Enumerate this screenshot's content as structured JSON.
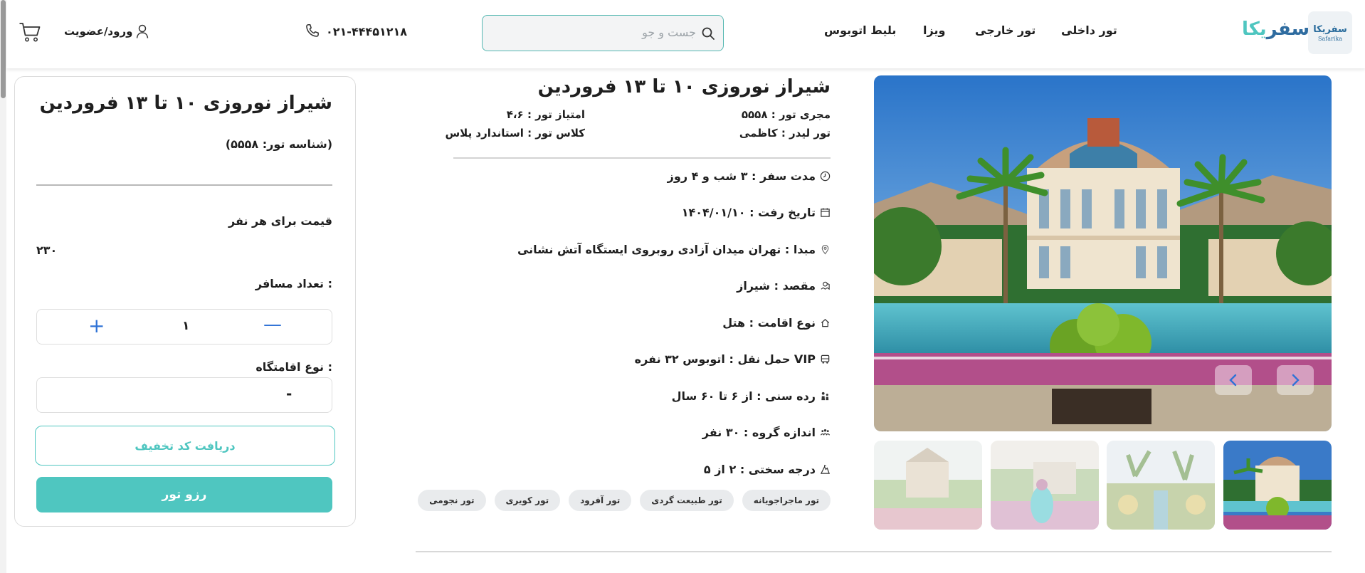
{
  "header": {
    "logo_text_part1": "سفر",
    "logo_text_part2": "یکا",
    "logo_mark": "سفریکا",
    "logo_sub": "Safarika",
    "nav": [
      "تور داخلی",
      "تور خارجی",
      "ویزا",
      "بلیط اتوبوس"
    ],
    "search_placeholder": "جست و جو",
    "phone": "۰۲۱-۴۴۴۵۱۲۱۸",
    "login_label": "ورود/عضویت"
  },
  "gallery": {
    "thumbnail_count": 4,
    "selected_thumbnail": 1
  },
  "tour": {
    "title": "شیراز نوروزی ۱۰ تا ۱۳ فروردین",
    "operator": "مجری تور : ۵۵۵۸",
    "rating": "امتیاز تور : ۴،۶",
    "leader": "تور لیدر : کاظمی",
    "class": "کلاس تور : استاندارد پلاس",
    "details": [
      {
        "icon": "clock-icon",
        "text": "مدت سفر : ۳ شب و ۴ روز"
      },
      {
        "icon": "calendar-icon",
        "text": "تاریخ رفت : ۱۴۰۴/۰۱/۱۰"
      },
      {
        "icon": "location-pin-icon",
        "text": "مبدا : تهران میدان آزادی روبروی ایستگاه آتش نشانی"
      },
      {
        "icon": "map-pin-icon",
        "text": "مقصد : شیراز"
      },
      {
        "icon": "home-icon",
        "text": "نوع اقامت : هتل"
      },
      {
        "icon": "bus-icon",
        "text": "حمل نقل : اتوبوس ۳۲ نفره VIP"
      },
      {
        "icon": "age-group-icon",
        "text": "رده سنی : از ۶ تا ۶۰ سال"
      },
      {
        "icon": "group-icon",
        "text": "اندازه گروه : ۳۰ نفر"
      },
      {
        "icon": "difficulty-icon",
        "text": "درجه سختی : ۲ از ۵"
      }
    ],
    "tags": [
      "تور ماجراجویانه",
      "تور طبیعت گردی",
      "تور آفرود",
      "تور کویری",
      "تور نجومی"
    ]
  },
  "booking": {
    "title": "شیراز نوروزی ۱۰ تا ۱۳ فروردین",
    "tour_id": "(شناسه تور: ۵۵۵۸)",
    "price_label": "قیمت برای هر نفر",
    "price": "۲۳۰",
    "passengers_label": "تعداد مسافر :",
    "passengers_value": "۱",
    "accommodation_label": "نوع اقامتگاه :",
    "accommodation_value": "-",
    "discount_button": "دریافت کد تخفیف",
    "reserve_button": "رزو تور"
  },
  "colors": {
    "accent": "#4fc6c0",
    "brand_blue": "#2f6ca0",
    "stepper_blue": "#2f72d6"
  }
}
